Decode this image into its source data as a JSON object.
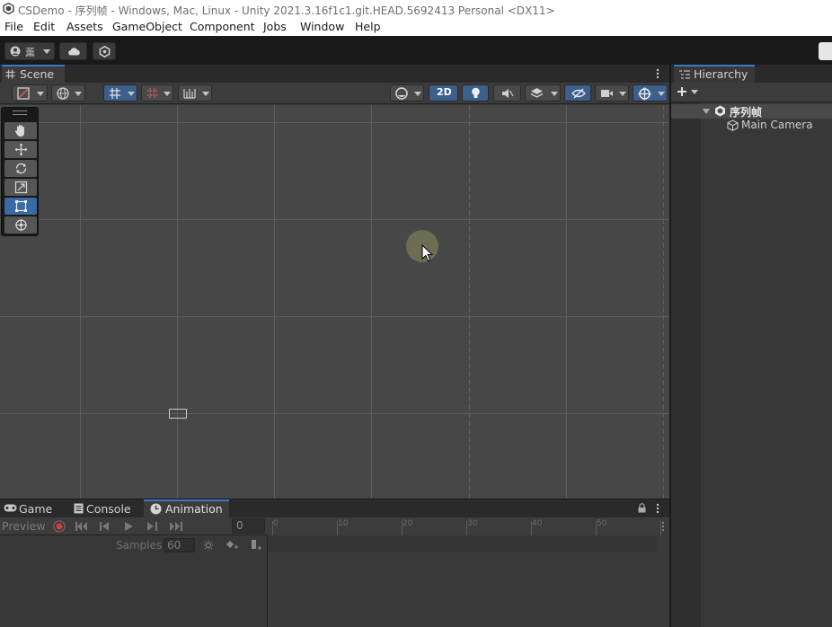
{
  "window": {
    "title": "CSDemo - 序列帧 - Windows, Mac, Linux - Unity 2021.3.16f1c1.git.HEAD.5692413 Personal <DX11>"
  },
  "menu": {
    "items": [
      "File",
      "Edit",
      "Assets",
      "GameObject",
      "Component",
      "Jobs",
      "Window",
      "Help"
    ]
  },
  "toolbar": {
    "account_label": "薰"
  },
  "scene": {
    "tab_label": "Scene",
    "toggle_2d_label": "2D"
  },
  "hierarchy": {
    "tab_label": "Hierarchy",
    "scene_name": "序列帧",
    "objects": [
      "Main Camera"
    ]
  },
  "bottom": {
    "tabs": [
      "Game",
      "Console",
      "Animation"
    ],
    "preview_label": "Preview",
    "frame_value": "0",
    "samples_label": "Samples",
    "samples_value": "60",
    "ruler_ticks": [
      "0",
      "10",
      "20",
      "30",
      "40",
      "50"
    ]
  },
  "colors": {
    "accent": "#3a78c9",
    "selection": "#3c5f8c",
    "record": "#d23c3c"
  }
}
